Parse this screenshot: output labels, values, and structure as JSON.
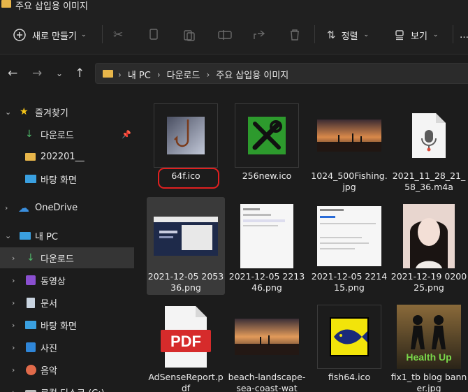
{
  "window": {
    "title": "주요 삽입용 이미지"
  },
  "toolbar": {
    "new_label": "새로 만들기",
    "sort_label": "정렬",
    "view_label": "보기",
    "more": "…"
  },
  "address": {
    "crumbs": [
      "내 PC",
      "다운로드",
      "주요 삽입용 이미지"
    ]
  },
  "sidebar": {
    "items": [
      {
        "label": "즐겨찾기"
      },
      {
        "label": "다운로드"
      },
      {
        "label": "202201__"
      },
      {
        "label": "바탕 화면"
      },
      {
        "label": "OneDrive"
      },
      {
        "label": "내 PC"
      },
      {
        "label": "다운로드"
      },
      {
        "label": "동영상"
      },
      {
        "label": "문서"
      },
      {
        "label": "바탕 화면"
      },
      {
        "label": "사진"
      },
      {
        "label": "음악"
      },
      {
        "label": "로컬 디스크 (C:)"
      }
    ]
  },
  "files": [
    {
      "name": "64f.ico"
    },
    {
      "name": "256new.ico"
    },
    {
      "name": "1024_500Fishing.jpg"
    },
    {
      "name": "2021_11_28_21_58_36.m4a"
    },
    {
      "name": "2021-12-05 2053 36.png"
    },
    {
      "name": "2021-12-05 2213 46.png"
    },
    {
      "name": "2021-12-05 2214 15.png"
    },
    {
      "name": "2021-12-19 0200 25.png"
    },
    {
      "name": "AdSenseReport.pdf"
    },
    {
      "name": "beach-landscape-sea-coast-wat"
    },
    {
      "name": "fish64.ico"
    },
    {
      "name": "fix1_tb blog banner.jpg"
    }
  ],
  "thumbs": {
    "pdf_text": "PDF",
    "health_text": "Health Up"
  },
  "colors": {
    "accent_folder": "#e8b64a",
    "highlight_circle": "#e02020",
    "selected_bg": "#3a3a3a"
  }
}
